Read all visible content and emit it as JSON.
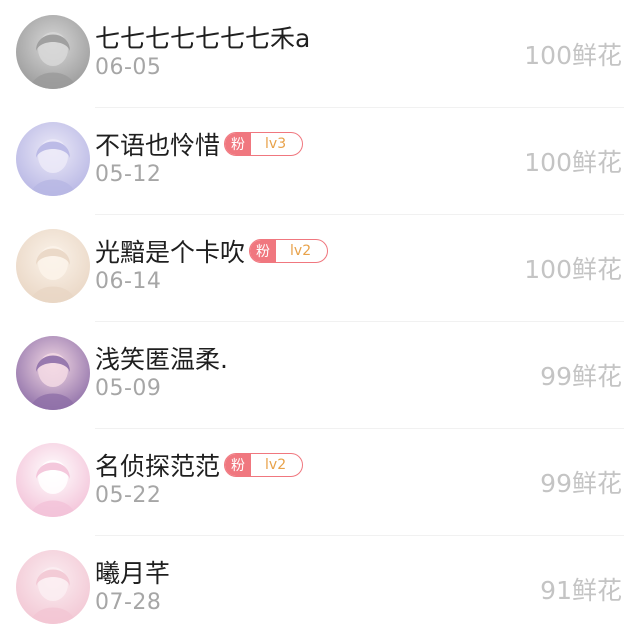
{
  "ranking": {
    "fan_tag_label": "粉",
    "items": [
      {
        "name": "七七七七七七七禾a",
        "date": "06-05",
        "amount": "100",
        "unit": "鲜花",
        "fan_level": null,
        "avatar_icon": "avatar-grayscale-icon",
        "avatar_colors": [
          "#9a9a9a",
          "#d8d8d8"
        ]
      },
      {
        "name": "不语也怜惜",
        "date": "05-12",
        "amount": "100",
        "unit": "鲜花",
        "fan_level": "lv3",
        "avatar_icon": "avatar-anime-girl-icon",
        "avatar_colors": [
          "#b7b6e4",
          "#eceaf8"
        ]
      },
      {
        "name": "光黯是个卡吹",
        "date": "06-14",
        "amount": "100",
        "unit": "鲜花",
        "fan_level": "lv2",
        "avatar_icon": "avatar-anime-girl-icon",
        "avatar_colors": [
          "#e9d6c4",
          "#fbf3ea"
        ]
      },
      {
        "name": "浅笑匿温柔.",
        "date": "05-09",
        "amount": "99",
        "unit": "鲜花",
        "fan_level": null,
        "avatar_icon": "avatar-anime-girl-icon",
        "avatar_colors": [
          "#8e6fa8",
          "#f3d9e4"
        ]
      },
      {
        "name": "名侦探范范",
        "date": "05-22",
        "amount": "99",
        "unit": "鲜花",
        "fan_level": "lv2",
        "avatar_icon": "avatar-chibi-icon",
        "avatar_colors": [
          "#f3c2d8",
          "#ffffff"
        ]
      },
      {
        "name": "曦月芊",
        "date": "07-28",
        "amount": "91",
        "unit": "鲜花",
        "fan_level": null,
        "avatar_icon": "avatar-anime-girl-icon",
        "avatar_colors": [
          "#f2c6d3",
          "#fbeef2"
        ]
      }
    ]
  }
}
